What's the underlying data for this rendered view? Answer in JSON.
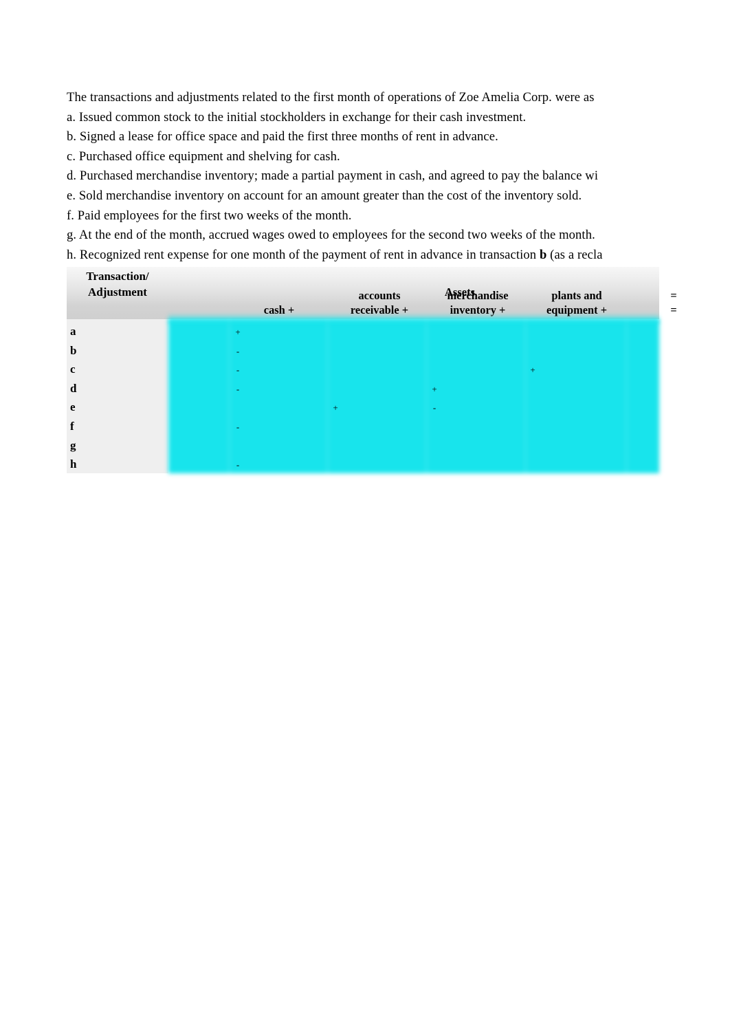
{
  "document": {
    "lines": [
      "The transactions and adjustments related to the first month of operations of Zoe Amelia Corp. were as",
      "a. Issued common stock to the initial stockholders in exchange for their cash investment.",
      "b. Signed a lease for office space and paid the first three months of rent in advance.",
      "c. Purchased office equipment and shelving for cash.",
      "d. Purchased merchandise inventory; made a partial payment in cash, and agreed to pay the balance wi",
      "e. Sold merchandise inventory on account for an amount greater than the cost of the inventory sold.",
      "f. Paid employees for the first two weeks of the month.",
      "g. At the end of the month, accrued wages owed to employees for the second two weeks of the month."
    ],
    "last_line_prefix": "h. Recognized rent expense for one month of the payment of rent in advance in transaction ",
    "last_line_bold": "b",
    "last_line_suffix": " (as a recla"
  },
  "table": {
    "group_header": "Assets",
    "transaction_header_line1": "Transaction/",
    "transaction_header_line2": "Adjustment",
    "columns": [
      {
        "id": "cash",
        "line1": "",
        "line2": "cash +"
      },
      {
        "id": "ar",
        "line1": "accounts",
        "line2": "receivable +"
      },
      {
        "id": "mi",
        "line1": "merchandise",
        "line2": "inventory +"
      },
      {
        "id": "pe",
        "line1": "plants and",
        "line2": "equipment +"
      },
      {
        "id": "equals",
        "line1": "=",
        "line2": "="
      }
    ],
    "rows": [
      {
        "label": "a",
        "cash": "+",
        "ar": "",
        "mi": "",
        "pe": "",
        "equals": ""
      },
      {
        "label": "b",
        "cash": "-",
        "ar": "",
        "mi": "",
        "pe": "",
        "equals": ""
      },
      {
        "label": "c",
        "cash": "-",
        "ar": "",
        "mi": "",
        "pe": "+",
        "equals": ""
      },
      {
        "label": "d",
        "cash": "-",
        "ar": "",
        "mi": "+",
        "pe": "",
        "equals": ""
      },
      {
        "label": "e",
        "cash": "",
        "ar": "+",
        "mi": "-",
        "pe": "",
        "equals": ""
      },
      {
        "label": "f",
        "cash": "-",
        "ar": "",
        "mi": "",
        "pe": "",
        "equals": ""
      },
      {
        "label": "g",
        "cash": "",
        "ar": "",
        "mi": "",
        "pe": "",
        "equals": ""
      },
      {
        "label": "h",
        "cash": "-",
        "ar": "",
        "mi": "",
        "pe": "",
        "equals": ""
      }
    ]
  },
  "colors": {
    "cyan_fill": "#18e4ec",
    "header_gray_top": "#f7f7f7",
    "header_gray_bottom": "#cfcfcf",
    "label_column": "#efefef",
    "text": "#000000"
  }
}
